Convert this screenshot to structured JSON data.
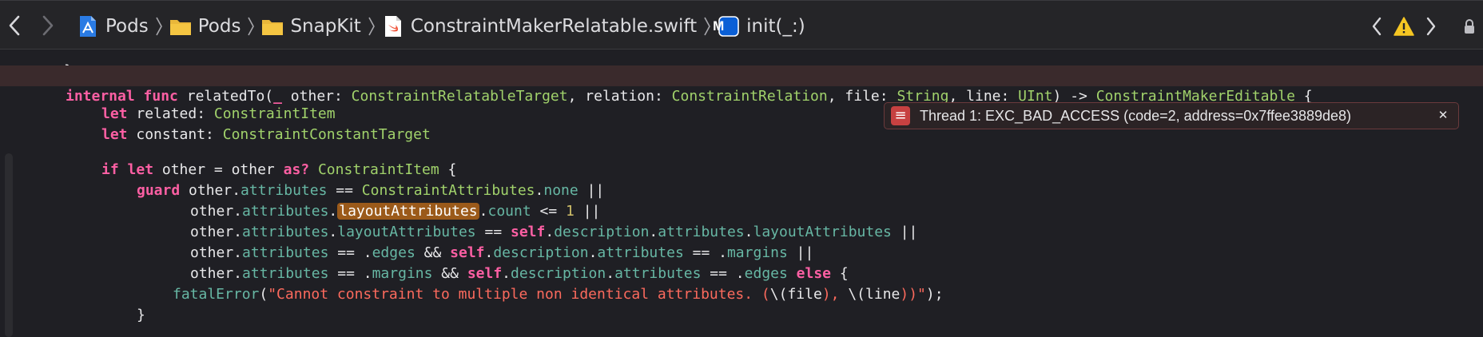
{
  "breadcrumbs": [
    {
      "label": "Pods",
      "icon": "project-icon"
    },
    {
      "label": "Pods",
      "icon": "folder-icon"
    },
    {
      "label": "SnapKit",
      "icon": "folder-icon"
    },
    {
      "label": "ConstraintMakerRelatable.swift",
      "icon": "swift-file-icon"
    },
    {
      "label": "init(_:)",
      "icon": "method-icon",
      "badge": "M"
    }
  ],
  "colors": {
    "accent": "#0a5fd6",
    "folder": "#f4c542",
    "swift": "#f05138",
    "error": "#c74141",
    "warning": "#f5c623"
  },
  "error": {
    "message": "Thread 1: EXC_BAD_ACCESS (code=2, address=0x7ffee3889de8)",
    "badge": "≡",
    "close": "✕"
  },
  "code": {
    "l1": {
      "kw1": "internal",
      "kw2": "func",
      "name": "relatedTo(",
      "kw3": "_",
      "p1": " other: ",
      "t1": "ConstraintRelatableTarget",
      "p2": ", relation: ",
      "t2": "ConstraintRelation",
      "p3": ", file: ",
      "t3": "String",
      "p4": ", line: ",
      "t4": "UInt",
      "p5": ") -> ",
      "t5": "ConstraintMakerEditable",
      "p6": " {"
    },
    "l2": {
      "kw": "let",
      "p1": " related: ",
      "t1": "ConstraintItem"
    },
    "l3": {
      "kw": "let",
      "p1": " constant: ",
      "t1": "ConstraintConstantTarget"
    },
    "l4": {
      "kw1": "if",
      "kw2": "let",
      "p1": " other = other ",
      "kw3": "as?",
      "p2": " ",
      "t1": "ConstraintItem",
      "p3": " {"
    },
    "l5": {
      "kw": "guard",
      "p1": " other.",
      "m1": "attributes",
      "p2": " == ",
      "t1": "ConstraintAttributes",
      "p3": ".",
      "m2": "none",
      "p4": " ||"
    },
    "l6": {
      "p1": "other.",
      "m1": "attributes",
      "p2": ".",
      "hl": "layoutAttributes",
      "p3": ".",
      "m2": "count",
      "p4": " <= ",
      "n1": "1",
      "p5": " ||"
    },
    "l7": {
      "p1": "other.",
      "m1": "attributes",
      "p2": ".",
      "m2": "layoutAttributes",
      "p3": " == ",
      "kw": "self",
      "p4": ".",
      "m3": "description",
      "p5": ".",
      "m4": "attributes",
      "p6": ".",
      "m5": "layoutAttributes",
      "p7": " ||"
    },
    "l8": {
      "p1": "other.",
      "m1": "attributes",
      "p2": " == .",
      "m2": "edges",
      "p3": " && ",
      "kw": "self",
      "p4": ".",
      "m3": "description",
      "p5": ".",
      "m4": "attributes",
      "p6": " == .",
      "m5": "margins",
      "p7": " ||"
    },
    "l9": {
      "p1": "other.",
      "m1": "attributes",
      "p2": " == .",
      "m2": "margins",
      "p3": " && ",
      "kw": "self",
      "p4": ".",
      "m3": "description",
      "p5": ".",
      "m4": "attributes",
      "p6": " == .",
      "m5": "edges",
      "p7": " ",
      "kw2": "else",
      "p8": " {"
    },
    "l10": {
      "fn": "fatalError",
      "p1": "(",
      "s1": "\"Cannot constraint to multiple non identical attributes. (",
      "p2": "\\(",
      "p3": "file",
      "s2": "), ",
      "p4": "\\(",
      "p5": "line",
      "s3": "))\"",
      "p6": ");"
    },
    "l11": {
      "p1": "}"
    }
  }
}
